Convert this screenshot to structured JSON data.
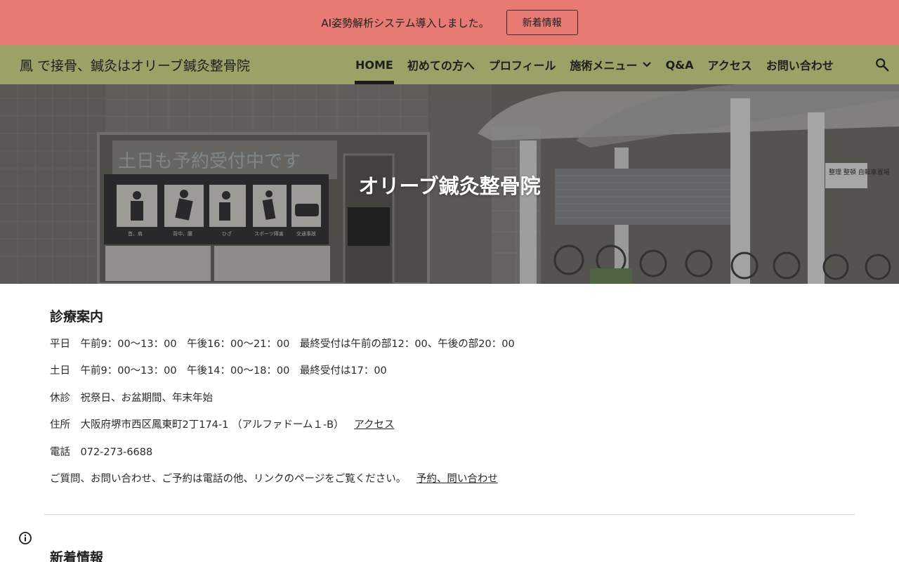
{
  "announcement": {
    "text": "AI姿勢解析システム導入しました。",
    "button_label": "新着情報"
  },
  "header": {
    "site_title": "鳳 で接骨、鍼灸はオリーブ鍼灸整骨院",
    "nav": [
      {
        "label": "HOME",
        "active": true
      },
      {
        "label": "初めての方へ"
      },
      {
        "label": "プロフィール"
      },
      {
        "label": "施術メニュー",
        "has_dropdown": true,
        "icon": "chevron-down-icon"
      },
      {
        "label": "Q&A"
      },
      {
        "label": "アクセス"
      },
      {
        "label": "お問い合わせ"
      }
    ],
    "search_icon": "search-icon"
  },
  "hero": {
    "title": "オリーブ鍼灸整骨院",
    "photo_sign_text": "土日も予約受付中です",
    "photo_icons": [
      "首、肩",
      "背中、腰",
      "ひざ",
      "スポーツ障害",
      "交通事故"
    ],
    "photo_right_sign": "整理 整頓 自転車置場"
  },
  "clinic_info": {
    "title": "診療案内",
    "lines": [
      "平日　午前9：00〜13：00　午後16：00〜21：00　最終受付は午前の部12：00、午後の部20：00",
      "土日　午前9：00〜13：00　午後14：00〜18：00　最終受付は17：00",
      "休診　祝祭日、お盆期間、年末年始"
    ],
    "address_text": "住所　大阪府堺市西区鳳東町2丁174-1 （アルファドーム１-B）",
    "address_link": "アクセス",
    "phone": "電話　072-273-6688",
    "inquiry_text": "ご質問、お問い合わせ、ご予約は電話の他、リンクのページをご覧ください。",
    "inquiry_link": "予約、問い合わせ"
  },
  "news": {
    "title": "新着情報"
  },
  "colors": {
    "announcement_bg": "#e77a72",
    "header_bg": "#9ba267",
    "text": "#1e1e1e"
  }
}
